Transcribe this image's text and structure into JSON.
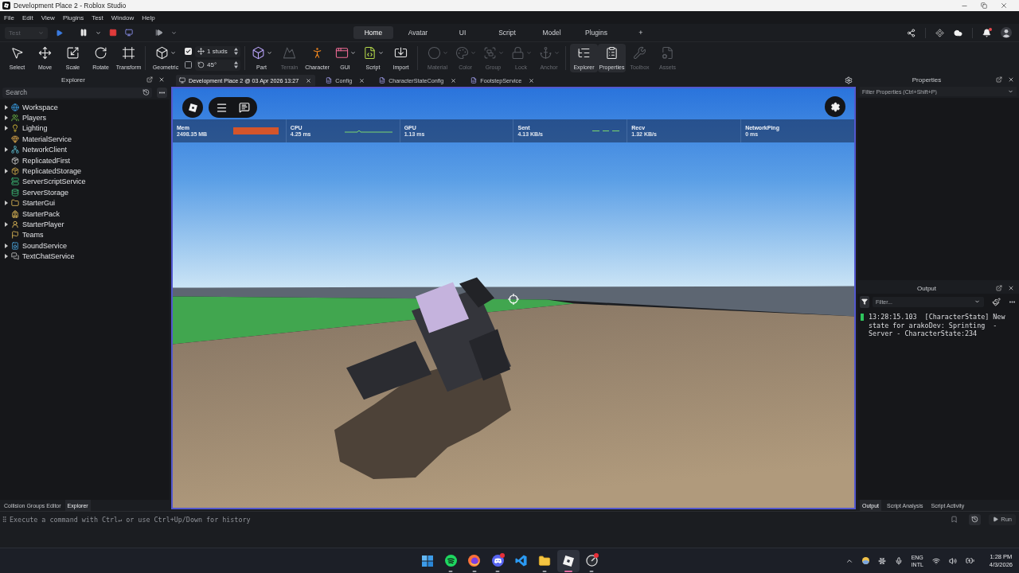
{
  "window": {
    "title": "Development Place 2 - Roblox Studio"
  },
  "menu_bar": [
    "File",
    "Edit",
    "View",
    "Plugins",
    "Test",
    "Window",
    "Help"
  ],
  "test_bar": {
    "mode": {
      "value": "Test",
      "disabled": true
    }
  },
  "ribbon_tabs": [
    {
      "label": "Home",
      "selected": true
    },
    {
      "label": "Avatar",
      "selected": false
    },
    {
      "label": "UI",
      "selected": false
    },
    {
      "label": "Script",
      "selected": false
    },
    {
      "label": "Model",
      "selected": false
    },
    {
      "label": "Plugins",
      "selected": false
    }
  ],
  "add_tab": "+",
  "account": {
    "notification": true
  },
  "toolbar": {
    "transform_tools": [
      {
        "label": "Select"
      },
      {
        "label": "Move"
      },
      {
        "label": "Scale"
      },
      {
        "label": "Rotate"
      },
      {
        "label": "Transform"
      }
    ],
    "collision_mode": {
      "label": "Geometric",
      "has_menu": true
    },
    "snapping": [
      {
        "kind": "move",
        "checked": true,
        "value": "1 studs"
      },
      {
        "kind": "rotate",
        "checked": false,
        "value": "45°"
      }
    ],
    "insert_tools": [
      {
        "label": "Part",
        "disabled": false,
        "has_menu": true
      },
      {
        "label": "Terrain",
        "disabled": true,
        "has_menu": false
      },
      {
        "label": "Character",
        "disabled": false,
        "has_menu": false
      },
      {
        "label": "GUI",
        "disabled": false,
        "has_menu": true
      },
      {
        "label": "Script",
        "disabled": false,
        "has_menu": true
      },
      {
        "label": "Import",
        "disabled": false,
        "has_menu": false
      }
    ],
    "edit_tools": [
      {
        "label": "Material",
        "disabled": true,
        "has_menu": true
      },
      {
        "label": "Color",
        "disabled": true,
        "has_menu": true
      },
      {
        "label": "Group",
        "disabled": true,
        "has_menu": true
      },
      {
        "label": "Lock",
        "disabled": true,
        "has_menu": true
      },
      {
        "label": "Anchor",
        "disabled": true,
        "has_menu": true
      }
    ],
    "panel_toggles": [
      {
        "label": "Explorer",
        "selected": true,
        "disabled": false
      },
      {
        "label": "Properties",
        "selected": true,
        "disabled": false
      },
      {
        "label": "Toolbox",
        "selected": false,
        "disabled": true
      },
      {
        "label": "Assets",
        "selected": false,
        "disabled": true
      }
    ]
  },
  "explorer": {
    "title": "Explorer",
    "search": {
      "placeholder": "Search"
    },
    "items": [
      {
        "label": "Workspace",
        "expandable": true,
        "expanded": false
      },
      {
        "label": "Players",
        "expandable": true,
        "expanded": false
      },
      {
        "label": "Lighting",
        "expandable": true,
        "expanded": false
      },
      {
        "label": "MaterialService",
        "expandable": false,
        "expanded": false
      },
      {
        "label": "NetworkClient",
        "expandable": true,
        "expanded": false
      },
      {
        "label": "ReplicatedFirst",
        "expandable": false,
        "expanded": false
      },
      {
        "label": "ReplicatedStorage",
        "expandable": true,
        "expanded": false
      },
      {
        "label": "ServerScriptService",
        "expandable": false,
        "expanded": false
      },
      {
        "label": "ServerStorage",
        "expandable": false,
        "expanded": false
      },
      {
        "label": "StarterGui",
        "expandable": true,
        "expanded": false
      },
      {
        "label": "StarterPack",
        "expandable": false,
        "expanded": false
      },
      {
        "label": "StarterPlayer",
        "expandable": true,
        "expanded": false
      },
      {
        "label": "Teams",
        "expandable": false,
        "expanded": false
      },
      {
        "label": "SoundService",
        "expandable": true,
        "expanded": false
      },
      {
        "label": "TextChatService",
        "expandable": true,
        "expanded": false
      }
    ]
  },
  "document_tabs": [
    {
      "kind": "place",
      "label": "Development Place 2 @ 03 Apr 2026 13:27",
      "selected": true
    },
    {
      "kind": "script",
      "label": "Config",
      "selected": false
    },
    {
      "kind": "script",
      "label": "CharacterStateConfig",
      "selected": false
    },
    {
      "kind": "script",
      "label": "FootstepService",
      "selected": false
    }
  ],
  "viewport": {
    "stats": [
      {
        "kind": "bar_graph",
        "name": "Mem",
        "value": "2498.35 MB"
      },
      {
        "kind": "line_graph",
        "name": "CPU",
        "value": "4.25 ms"
      },
      {
        "kind": "plain",
        "name": "GPU",
        "value": "1.13 ms"
      },
      {
        "kind": "dashed_graph",
        "name": "Sent",
        "value": "4.13 KB/s"
      },
      {
        "kind": "plain",
        "name": "Recv",
        "value": "1.32 KB/s"
      },
      {
        "kind": "plain",
        "name": "NetworkPing",
        "value": "0 ms"
      }
    ]
  },
  "properties": {
    "title": "Properties",
    "filter": {
      "placeholder": "Filter Properties (Ctrl+Shift+P)"
    }
  },
  "output": {
    "title": "Output",
    "filter": {
      "placeholder": "Filter..."
    },
    "messages": [
      {
        "kind": "info",
        "text": "13:28:15.103  [CharacterState] New state for arakoDev: Sprinting  - Server - CharacterState:234"
      }
    ]
  },
  "left_dock_tabs": [
    {
      "label": "Collision Groups Editor",
      "selected": false
    },
    {
      "label": "Explorer",
      "selected": true
    }
  ],
  "right_dock_tabs": [
    {
      "label": "Output",
      "selected": true
    },
    {
      "label": "Script Analysis",
      "selected": false
    },
    {
      "label": "Script Activity",
      "selected": false
    }
  ],
  "command_bar": {
    "placeholder": "Execute a command with Ctrl↵ or use Ctrl+Up/Down for history",
    "run_label": "Run"
  },
  "taskbar": {
    "apps": [
      {
        "running": false,
        "active": false,
        "badge": false
      },
      {
        "running": true,
        "active": false,
        "badge": false
      },
      {
        "running": true,
        "active": false,
        "badge": false
      },
      {
        "running": true,
        "active": false,
        "badge": true
      },
      {
        "running": false,
        "active": false,
        "badge": false
      },
      {
        "running": true,
        "active": false,
        "badge": false
      },
      {
        "running": true,
        "active": true,
        "badge": false
      },
      {
        "running": true,
        "active": false,
        "badge": true
      }
    ],
    "tray": {
      "language": "ENG",
      "layout": "INTL",
      "time": "1:28 PM",
      "date": "4/3/2026"
    }
  }
}
